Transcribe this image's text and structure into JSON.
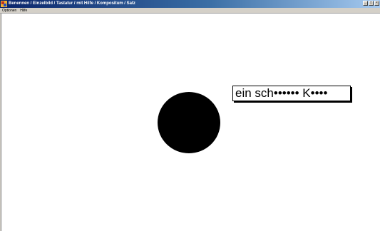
{
  "window": {
    "title": "Benennen / Einzelbild / Tastatur / mit Hilfe / Kompositum / Satz",
    "buttons": {
      "minimize": "_",
      "maximize": "□",
      "close": "×"
    }
  },
  "menu": {
    "items": [
      "Optionen",
      "Hilfe"
    ]
  },
  "stage": {
    "sentence": "ein sch•••••• K••••",
    "picture": "black-circle"
  },
  "colors": {
    "titlebar_start": "#0a246a",
    "titlebar_end": "#a6caf0",
    "menubar": "#d4d0c8",
    "canvas": "#ffffff",
    "picture": "#000000"
  }
}
